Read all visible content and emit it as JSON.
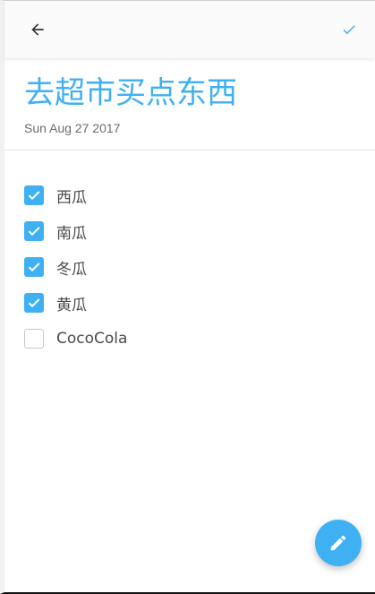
{
  "colors": {
    "accent": "#3fb0f2",
    "text": "#4a4a4a",
    "muted": "#6b6b6b"
  },
  "toolbar": {
    "back_icon": "arrow-left-icon",
    "done_icon": "check-icon"
  },
  "note": {
    "title": "去超市买点东西",
    "date": "Sun Aug 27 2017"
  },
  "items": [
    {
      "label": "西瓜",
      "checked": true
    },
    {
      "label": "南瓜",
      "checked": true
    },
    {
      "label": "冬瓜",
      "checked": true
    },
    {
      "label": "黄瓜",
      "checked": true
    },
    {
      "label": "CocoCola",
      "checked": false
    }
  ],
  "fab": {
    "icon": "pencil-icon"
  }
}
